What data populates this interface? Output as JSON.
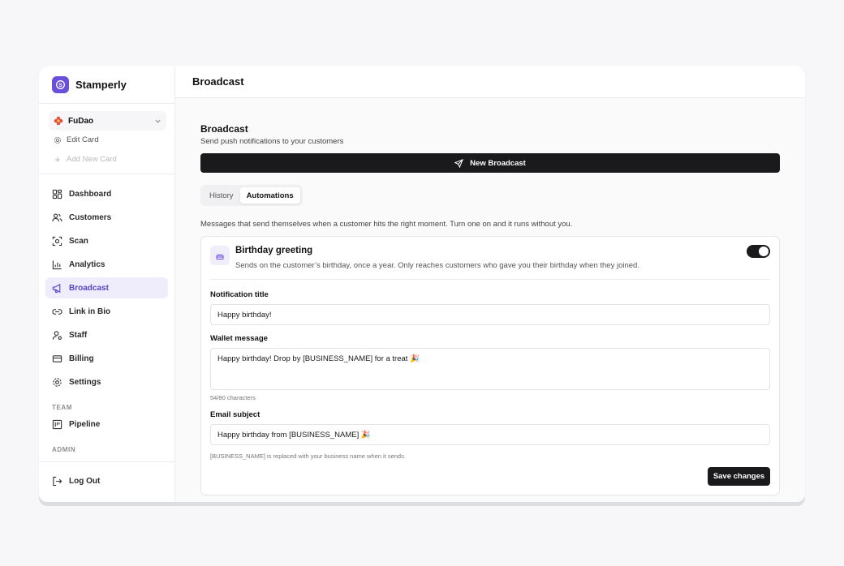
{
  "app": {
    "brand": "Stamperly"
  },
  "sidebar": {
    "card_selector": {
      "value": "FuDao"
    },
    "edit_card": "Edit Card",
    "add_new_card": "Add New Card",
    "items": [
      {
        "label": "Dashboard",
        "icon": "grid-icon"
      },
      {
        "label": "Customers",
        "icon": "users-icon"
      },
      {
        "label": "Scan",
        "icon": "scan-icon"
      },
      {
        "label": "Analytics",
        "icon": "chart-icon"
      },
      {
        "label": "Broadcast",
        "icon": "megaphone-icon",
        "active": true
      },
      {
        "label": "Link in Bio",
        "icon": "link-icon"
      },
      {
        "label": "Staff",
        "icon": "staff-icon"
      },
      {
        "label": "Billing",
        "icon": "card-icon"
      },
      {
        "label": "Settings",
        "icon": "gear-icon"
      }
    ],
    "team_label": "TEAM",
    "team_items": [
      {
        "label": "Pipeline",
        "icon": "pipeline-icon"
      }
    ],
    "admin_label": "ADMIN",
    "logout": "Log Out"
  },
  "header": {
    "title": "Broadcast"
  },
  "main": {
    "title": "Broadcast",
    "subtitle": "Send push notifications to your customers",
    "new_broadcast": "New Broadcast",
    "tabs": [
      {
        "label": "History"
      },
      {
        "label": "Automations",
        "active": true
      }
    ],
    "intro": "Messages that send themselves when a customer hits the right moment. Turn one on and it runs without you.",
    "automation": {
      "title": "Birthday greeting",
      "description": "Sends on the customer’s birthday, once a year. Only reaches customers who gave you their birthday when they joined.",
      "enabled": true,
      "notification_title_label": "Notification title",
      "notification_title_value": "Happy birthday!",
      "wallet_message_label": "Wallet message",
      "wallet_message_value": "Happy birthday! Drop by [BUSINESS_NAME] for a treat 🎉",
      "char_count": "54/80 characters",
      "email_subject_label": "Email subject",
      "email_subject_value": "Happy birthday from [BUSINESS_NAME] 🎉",
      "placeholder_hint": "[BUSINESS_NAME] is replaced with your business name when it sends.",
      "save_label": "Save changes"
    }
  },
  "colors": {
    "accent": "#6c4fd8",
    "active_bg": "#efecfb",
    "primary_btn": "#1a1a1c"
  }
}
